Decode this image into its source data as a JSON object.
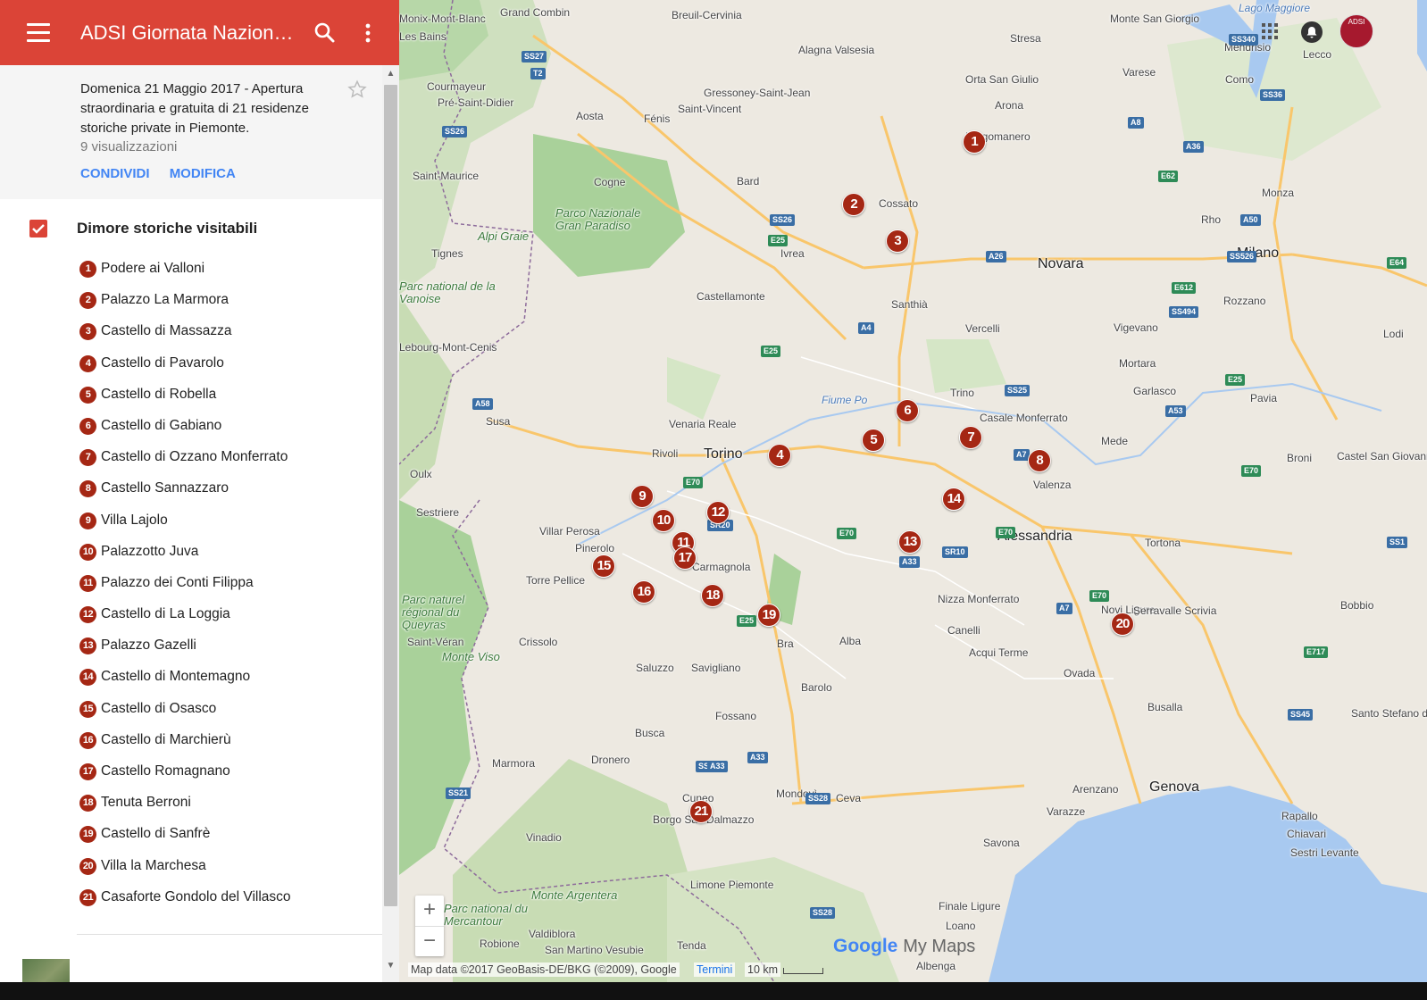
{
  "app": {
    "title": "ADSI Giornata Nazional…",
    "description": "Domenica 21 Maggio 2017 - Apertura straordinaria e gratuita di 21 residenze storiche private in Piemonte.",
    "views": "9 visualizzazioni",
    "share_label": "CONDIVIDI",
    "edit_label": "MODIFICA"
  },
  "layer": {
    "title": "Dimore storiche visitabili",
    "checked": true,
    "items": [
      {
        "num": "1",
        "label": "Podere ai Valloni"
      },
      {
        "num": "2",
        "label": "Palazzo La Marmora"
      },
      {
        "num": "3",
        "label": "Castello di Massazza"
      },
      {
        "num": "4",
        "label": "Castello di Pavarolo"
      },
      {
        "num": "5",
        "label": "Castello di Robella"
      },
      {
        "num": "6",
        "label": "Castello di Gabiano"
      },
      {
        "num": "7",
        "label": "Castello di Ozzano Monferrato"
      },
      {
        "num": "8",
        "label": "Castello Sannazzaro"
      },
      {
        "num": "9",
        "label": "Villa Lajolo"
      },
      {
        "num": "10",
        "label": "Palazzotto Juva"
      },
      {
        "num": "11",
        "label": "Palazzo dei Conti Filippa"
      },
      {
        "num": "12",
        "label": "Castello di La Loggia"
      },
      {
        "num": "13",
        "label": "Palazzo Gazelli"
      },
      {
        "num": "14",
        "label": "Castello di Montemagno"
      },
      {
        "num": "15",
        "label": "Castello di Osasco"
      },
      {
        "num": "16",
        "label": "Castello di Marchierù"
      },
      {
        "num": "17",
        "label": "Castello Romagnano"
      },
      {
        "num": "18",
        "label": "Tenuta Berroni"
      },
      {
        "num": "19",
        "label": "Castello di Sanfrè"
      },
      {
        "num": "20",
        "label": "Villa la Marchesa"
      },
      {
        "num": "21",
        "label": "Casaforte Gondolo del Villasco"
      }
    ]
  },
  "map": {
    "markers": [
      "1",
      "2",
      "3",
      "4",
      "5",
      "6",
      "7",
      "8",
      "9",
      "10",
      "11",
      "12",
      "13",
      "14",
      "15",
      "16",
      "17",
      "18",
      "19",
      "20",
      "21"
    ],
    "cities_big": [
      "Torino",
      "Milano",
      "Novara",
      "Genova",
      "Alessandria"
    ],
    "cities": [
      "Monix-Mont-Blanc",
      "Les Bains",
      "Grand Combin",
      "Breuil-Cervinia",
      "Courmayeur",
      "Pré-Saint-Didier",
      "Aosta",
      "Fénis",
      "Saint-Vincent",
      "Gressoney-Saint-Jean",
      "Alagna Valsesia",
      "Stresa",
      "Orta San Giulio",
      "Arona",
      "Borgomanero",
      "Varese",
      "Como",
      "Lecco",
      "Mendrisio",
      "Monte San Giorgio",
      "Saint-Maurice",
      "Cogne",
      "Bard",
      "Cossato",
      "Rho",
      "Monza",
      "Tignes",
      "Ivrea",
      "Castellamonte",
      "Santhià",
      "Vercelli",
      "Vigevano",
      "Rozzano",
      "Lodi",
      "Mortara",
      "Pavia",
      "Garlasco",
      "Trino",
      "Casale Monferrato",
      "Mede",
      "Broni",
      "Castel San Giovanni",
      "Susa",
      "Venaria Reale",
      "Rivoli",
      "Oulx",
      "Valenza",
      "Sestriere",
      "Villar Perosa",
      "Pinerolo",
      "Carmagnola",
      "Tortona",
      "Torre Pellice",
      "Nizza Monferrato",
      "Canelli",
      "Novi Ligure",
      "Serravalle Scrivia",
      "Bobbio",
      "Saint-Véran",
      "Crissolo",
      "Bra",
      "Alba",
      "Acqui Terme",
      "Saluzzo",
      "Savigliano",
      "Barolo",
      "Ovada",
      "Fossano",
      "Busalla",
      "Santo Stefano d'Aveto",
      "Busca",
      "Marmora",
      "Dronero",
      "Arenzano",
      "Rapallo",
      "Chiavari",
      "Sestri Levante",
      "Cuneo",
      "Mondovì",
      "Ceva",
      "Varazze",
      "Borgo San Dalmazzo",
      "Vinadio",
      "Savona",
      "Limone Piemonte",
      "Finale Ligure",
      "Valdiblora",
      "San Martino Vesubie",
      "Robione",
      "Tenda",
      "Loano",
      "Albenga",
      "Lebourg-Mont-Cenis"
    ],
    "parks": [
      "Parco Nazionale Gran Paradiso",
      "Alpi Graie",
      "Parc national de la Vanoise",
      "Parc naturel régional du Queyras",
      "Monte Viso",
      "Monte Argentera",
      "Parc national du Mercantour"
    ],
    "water": [
      "Fiume Po",
      "Lago Maggiore"
    ],
    "roads": [
      "SS27",
      "T2",
      "SS26",
      "A8",
      "A36",
      "E62",
      "SS340",
      "SS36",
      "SS26",
      "E25",
      "A26",
      "A4",
      "E25",
      "E612",
      "SS494",
      "SS526",
      "A50",
      "E64",
      "A58",
      "SS25",
      "E25",
      "A53",
      "A7",
      "E70",
      "E70",
      "E70",
      "SR20",
      "E70",
      "A33",
      "SR10",
      "E70",
      "A7",
      "E25",
      "E717",
      "SS45",
      "A33",
      "A33",
      "SS28",
      "SS21",
      "SS28",
      "SS45",
      "SS1"
    ],
    "zoom_in": "+",
    "zoom_out": "−",
    "logo_google": "Google",
    "logo_mymaps": "My Maps",
    "attribution": "Map data ©2017 GeoBasis-DE/BKG (©2009), Google",
    "terms": "Termini",
    "scale": "10 km",
    "avatar_text": "ADSI"
  },
  "colors": {
    "appbar": "#db4437",
    "marker": "#a52714",
    "link": "#4285f4"
  }
}
